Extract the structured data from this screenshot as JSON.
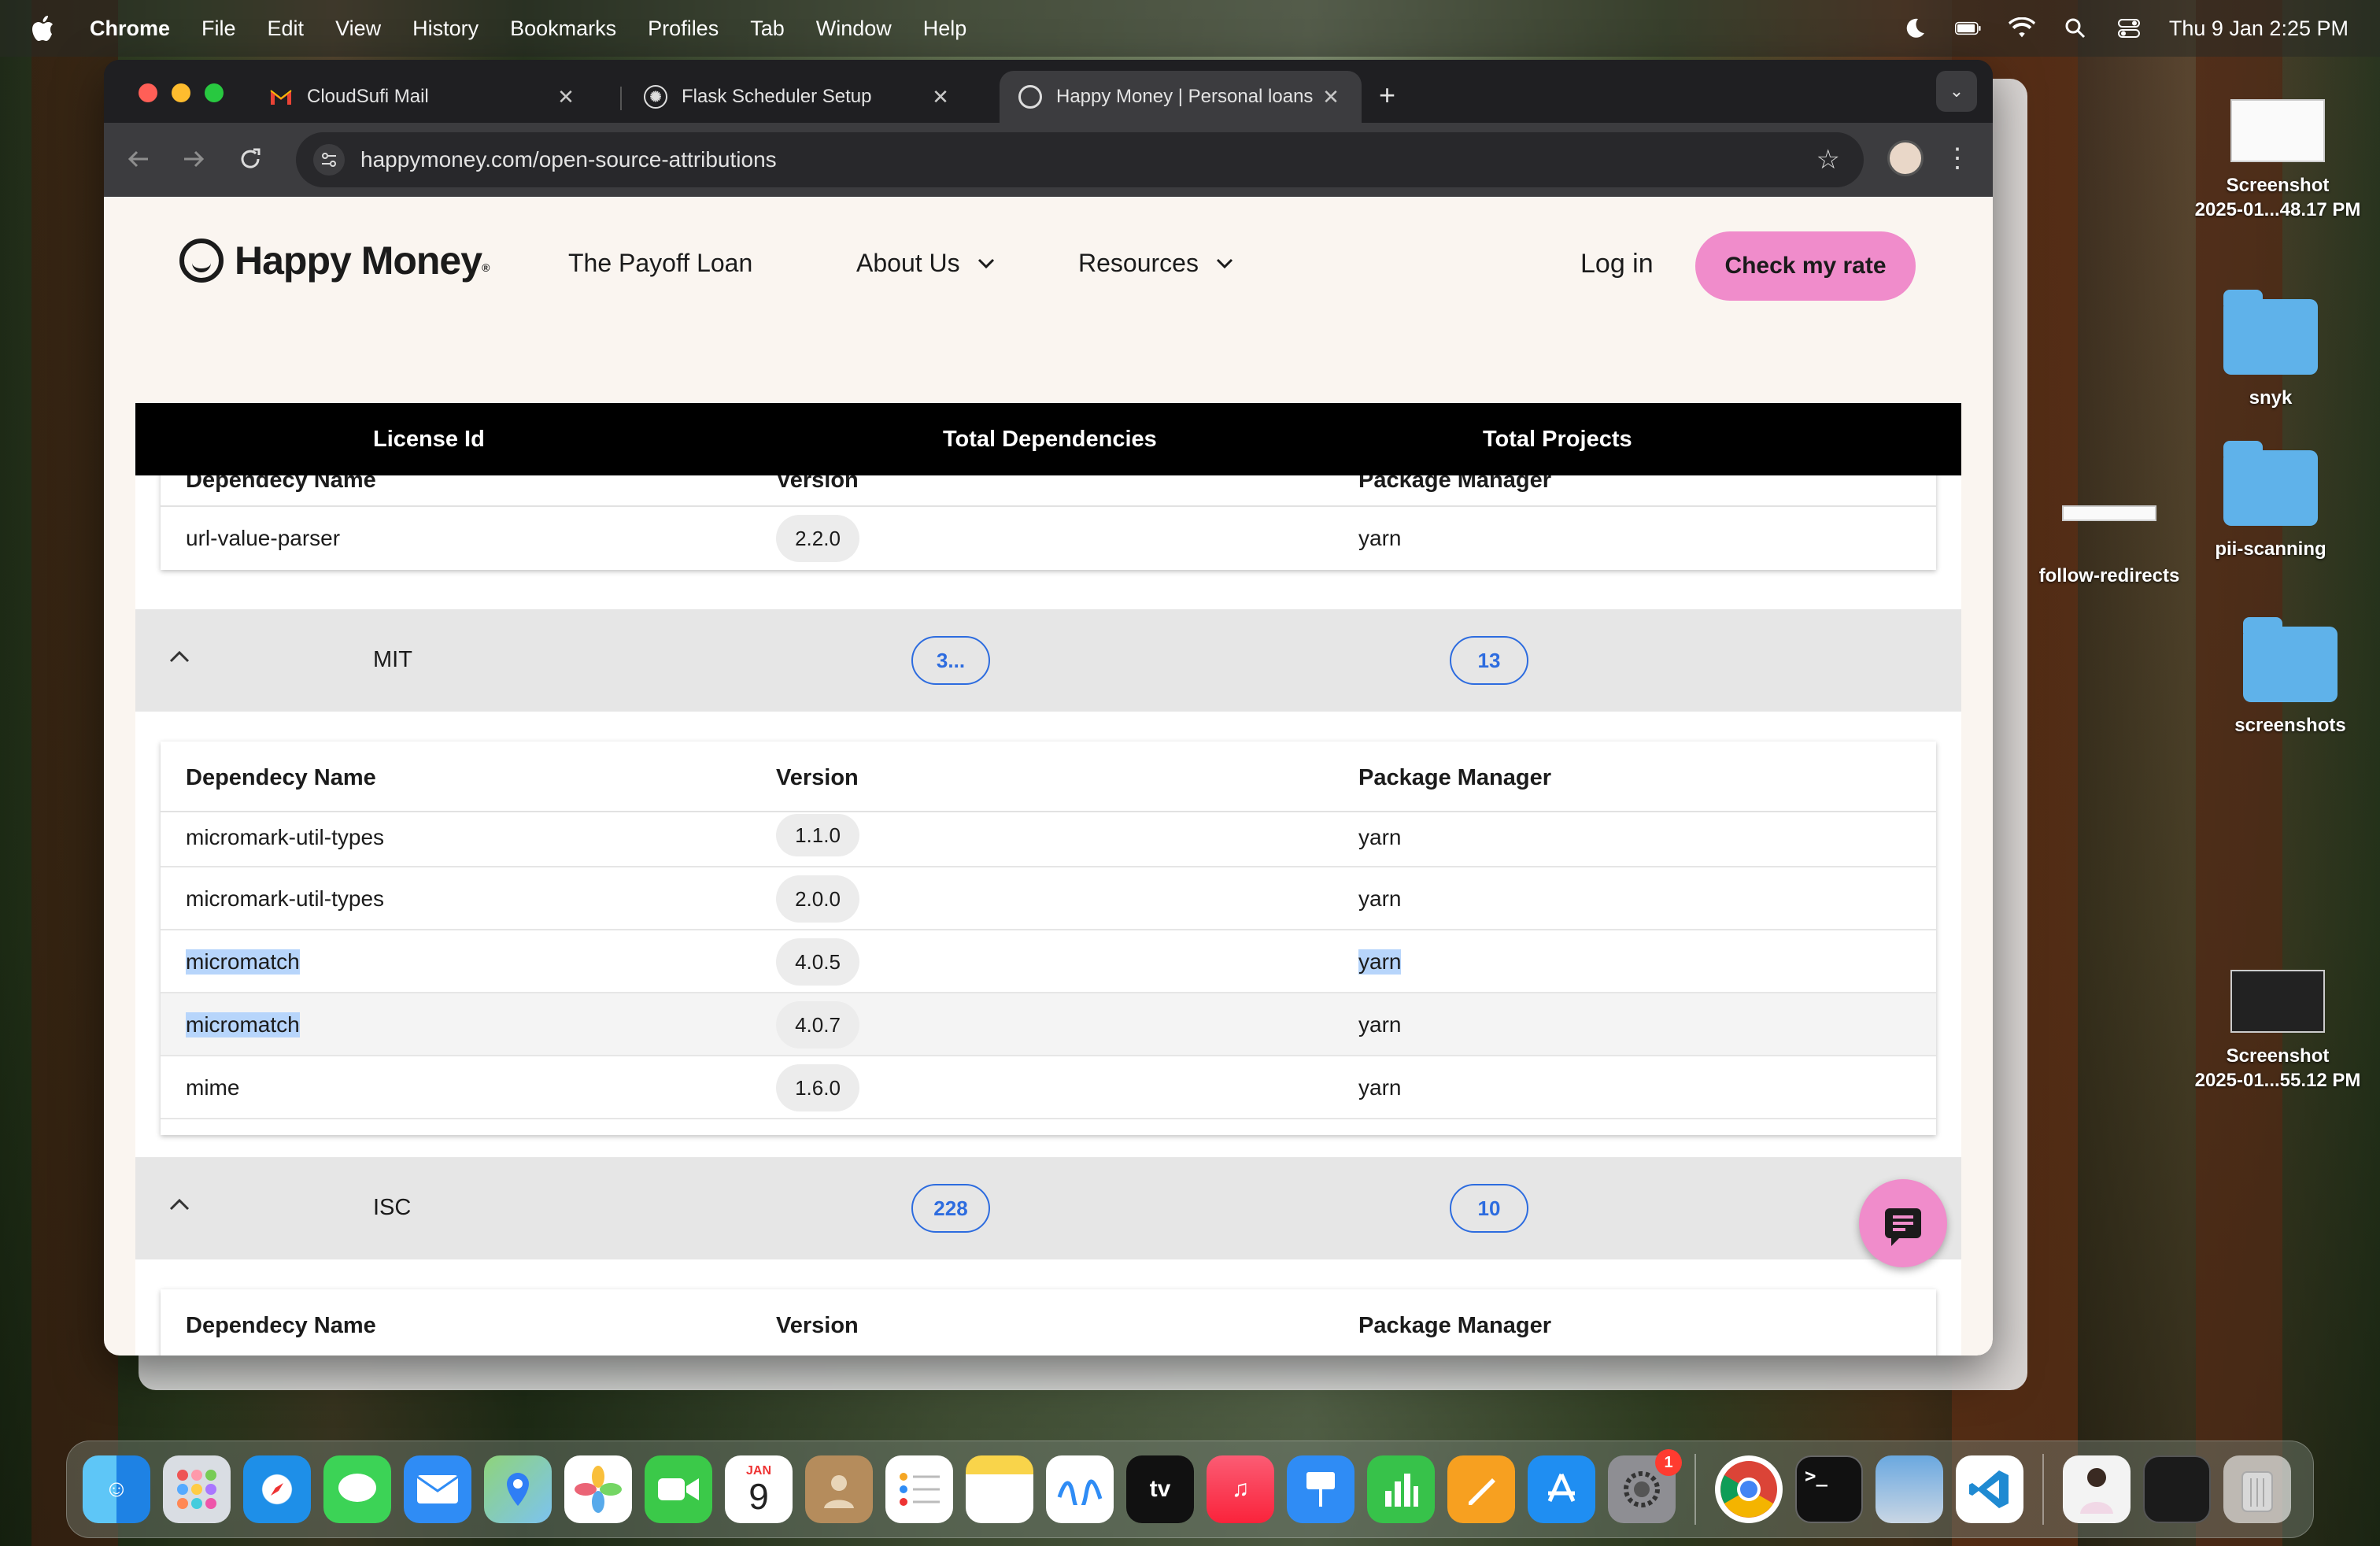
{
  "menubar": {
    "app": "Chrome",
    "items": [
      "File",
      "Edit",
      "View",
      "History",
      "Bookmarks",
      "Profiles",
      "Tab",
      "Window",
      "Help"
    ],
    "clock": "Thu 9 Jan  2:25 PM"
  },
  "browser": {
    "tabs": [
      {
        "title": "CloudSufi Mail",
        "icon": "gmail-icon"
      },
      {
        "title": "Flask Scheduler Setup",
        "icon": "chatgpt-icon"
      },
      {
        "title": "Happy Money | Personal loans",
        "icon": "happy-money-icon"
      }
    ],
    "url": "happymoney.com/open-source-attributions"
  },
  "site": {
    "logo": "Happy Money",
    "logo_mark": "®",
    "nav": {
      "payoff": "The Payoff Loan",
      "about": "About Us",
      "resources": "Resources"
    },
    "login": "Log in",
    "cta": "Check my rate"
  },
  "table": {
    "headers": {
      "license": "License Id",
      "deps": "Total Dependencies",
      "projects": "Total Projects"
    },
    "sub_headers": {
      "name": "Dependecy Name",
      "version": "Version",
      "pm": "Package Manager"
    },
    "top_rows": [
      {
        "name": "url-value-parser",
        "version": "2.2.0",
        "pm": "yarn"
      }
    ],
    "groups": [
      {
        "license": "MIT",
        "deps": "3...",
        "projects": "13",
        "rows": [
          {
            "name": "micromark-util-types",
            "version": "1.1.0",
            "pm": "yarn"
          },
          {
            "name": "micromark-util-types",
            "version": "2.0.0",
            "pm": "yarn"
          },
          {
            "name": "micromatch",
            "version": "4.0.5",
            "pm": "yarn"
          },
          {
            "name": "micromatch",
            "version": "4.0.7",
            "pm": "yarn"
          },
          {
            "name": "mime",
            "version": "1.6.0",
            "pm": "yarn"
          }
        ]
      },
      {
        "license": "ISC",
        "deps": "228",
        "projects": "10"
      }
    ]
  },
  "desktop": {
    "items": [
      {
        "label": "Screenshot\n2025-01...48.17 PM"
      },
      {
        "label": "snyk"
      },
      {
        "label": "pii-scanning"
      },
      {
        "label": "follow-redirects"
      },
      {
        "label": "screenshots"
      },
      {
        "label": "Screenshot\n2025-01...55.12 PM"
      }
    ]
  },
  "dock": {
    "calendar_month": "JAN",
    "calendar_day": "9",
    "settings_badge": "1"
  }
}
